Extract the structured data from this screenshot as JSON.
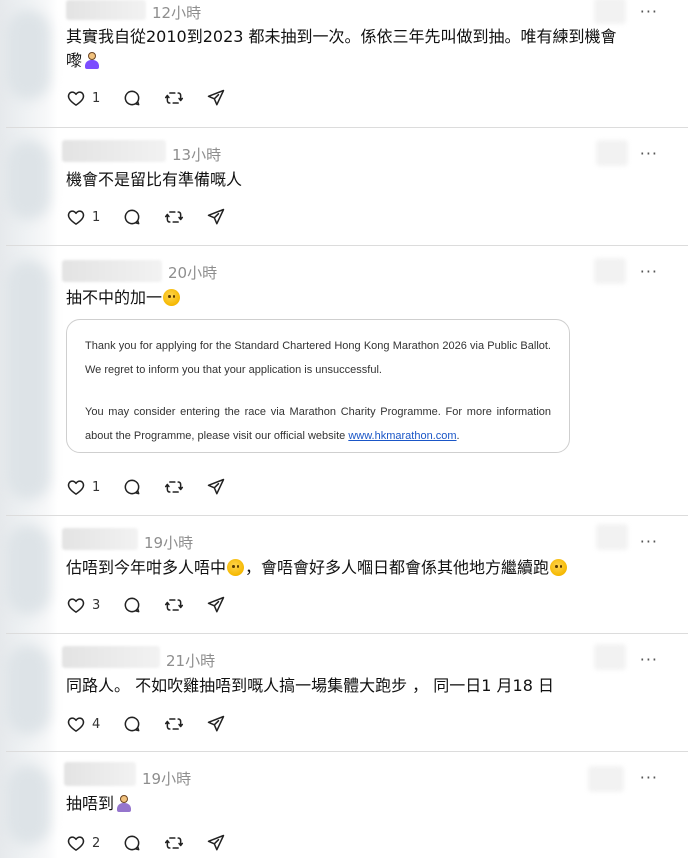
{
  "posts": [
    {
      "time": "12小時",
      "text": "其實我自從2010到2023 都未抽到一次。係依三年先叫做到抽。唯有練到機會",
      "text2": "嚟",
      "likes": "1",
      "more": "···"
    },
    {
      "time": "13小時",
      "text": "機會不是留比有準備嘅人",
      "likes": "1",
      "more": "···"
    },
    {
      "time": "20小時",
      "text": "抽不中的加一",
      "likes": "1",
      "more": "···",
      "card": {
        "para1": "Thank you for applying for the Standard Chartered Hong Kong Marathon 2026 via Public Ballot. We regret to inform you that your application is unsuccessful.",
        "para2_prefix": "You may consider entering the race via Marathon Charity Programme. For more information about the Programme, please visit our official website ",
        "link": "www.hkmarathon.com",
        "para2_suffix": "."
      }
    },
    {
      "time": "19小時",
      "text_a": "估唔到今年咁多人唔中",
      "text_b": "，會唔會好多人嗰日都會係其他地方繼續跑",
      "likes": "3",
      "more": "···"
    },
    {
      "time": "21小時",
      "text": "同路人。 不如吹雞抽唔到嘅人搞一場集體大跑步 ， 同一日1 月18 日",
      "likes": "4",
      "more": "···"
    },
    {
      "time": "19小時",
      "text": "抽唔到",
      "likes": "2",
      "more": "···"
    }
  ],
  "icons": {
    "like": "heart-icon",
    "reply": "comment-icon",
    "repost": "repost-icon",
    "share": "send-icon"
  },
  "colors": {
    "text": "#111111",
    "muted": "#8e8e8e",
    "divider": "#dcdcdc",
    "link": "#1a56c7"
  }
}
